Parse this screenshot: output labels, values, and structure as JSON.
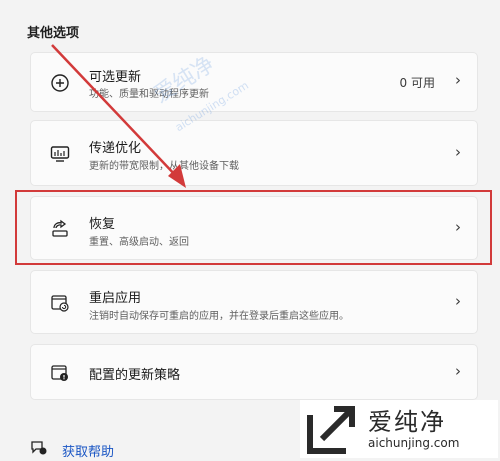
{
  "section_title": "其他选项",
  "items": [
    {
      "title": "可选更新",
      "subtitle": "功能、质量和驱动程序更新",
      "value": "0 可用",
      "icon": "plus-circle-icon"
    },
    {
      "title": "传递优化",
      "subtitle": "更新的带宽限制，从其他设备下载",
      "icon": "delivery-optimization-icon"
    },
    {
      "title": "恢复",
      "subtitle": "重置、高级启动、返回",
      "icon": "recovery-icon"
    },
    {
      "title": "重启应用",
      "subtitle": "注销时自动保存可重启的应用，并在登录后重启这些应用。",
      "icon": "restart-apps-icon"
    },
    {
      "title": "配置的更新策略",
      "subtitle": "",
      "icon": "policy-icon"
    }
  ],
  "chevron": "›",
  "help": {
    "label": "获取帮助",
    "icon": "help-icon"
  },
  "watermark": {
    "cn": "爱纯净",
    "en": "aichunjing.com",
    "url_small": "aichunjing.com"
  },
  "colors": {
    "highlight": "#d23a3a",
    "link": "#1a56c4",
    "background": "#f3f3f3"
  }
}
